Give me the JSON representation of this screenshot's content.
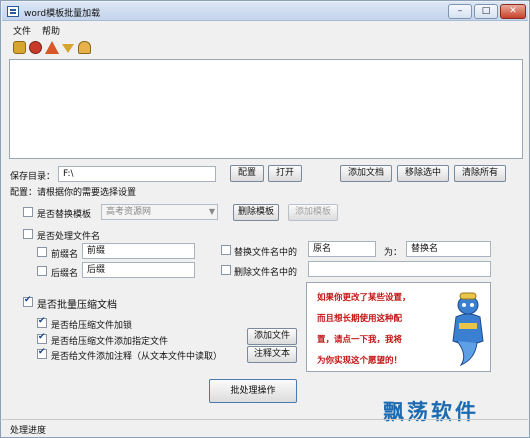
{
  "window": {
    "title": "word模板批量加载"
  },
  "menu": {
    "file": "文件",
    "help": "帮助"
  },
  "toolbar": [
    "lock-icon",
    "apple-icon",
    "warning-icon",
    "arrow-down-icon",
    "person-icon"
  ],
  "save_dir": {
    "label": "保存目录：",
    "value": "F:\\",
    "config_button": "配置",
    "open_button": "打开"
  },
  "doc_buttons": {
    "add": "添加文档",
    "remove": "移除选中",
    "clear": "清除所有"
  },
  "config_prompt": "配置：请根据你的需要选择设置",
  "template": {
    "checkbox_label": "是否替换模板",
    "selected": "高考资源网",
    "delete_button": "删除模板",
    "add_button": "添加模板"
  },
  "filename": {
    "checkbox_label": "是否处理文件名",
    "prefix_label": "前缀名",
    "prefix_value": "前缀",
    "suffix_label": "后缀名",
    "suffix_value": "后缀",
    "replace_label": "替换文件名中的",
    "original_value": "原名",
    "for_label": "为：",
    "replacement_value": "替换名",
    "delete_label": "删除文件名中的",
    "delete_value": ""
  },
  "compress": {
    "checkbox_label": "是否批量压缩文档",
    "lock_label": "是否给压缩文件加锁",
    "add_file_label": "是否给压缩文件添加指定文件",
    "comment_label": "是否给文件添加注释（从文本文件中读取）",
    "add_file_button": "添加文件",
    "comment_button": "注释文本"
  },
  "genie_message": [
    "如果你更改了某些设置，",
    "而且想长期使用这种配",
    "置，请点一下我，我将",
    "为你实现这个愿望的！"
  ],
  "batch_button": "批处理操作",
  "status": "处理进度",
  "watermark": "飘荡软件",
  "colors": {
    "genie_text": "#c41414",
    "watermark": "#1c6bb0",
    "title_gradient": "#c3d5ec"
  }
}
